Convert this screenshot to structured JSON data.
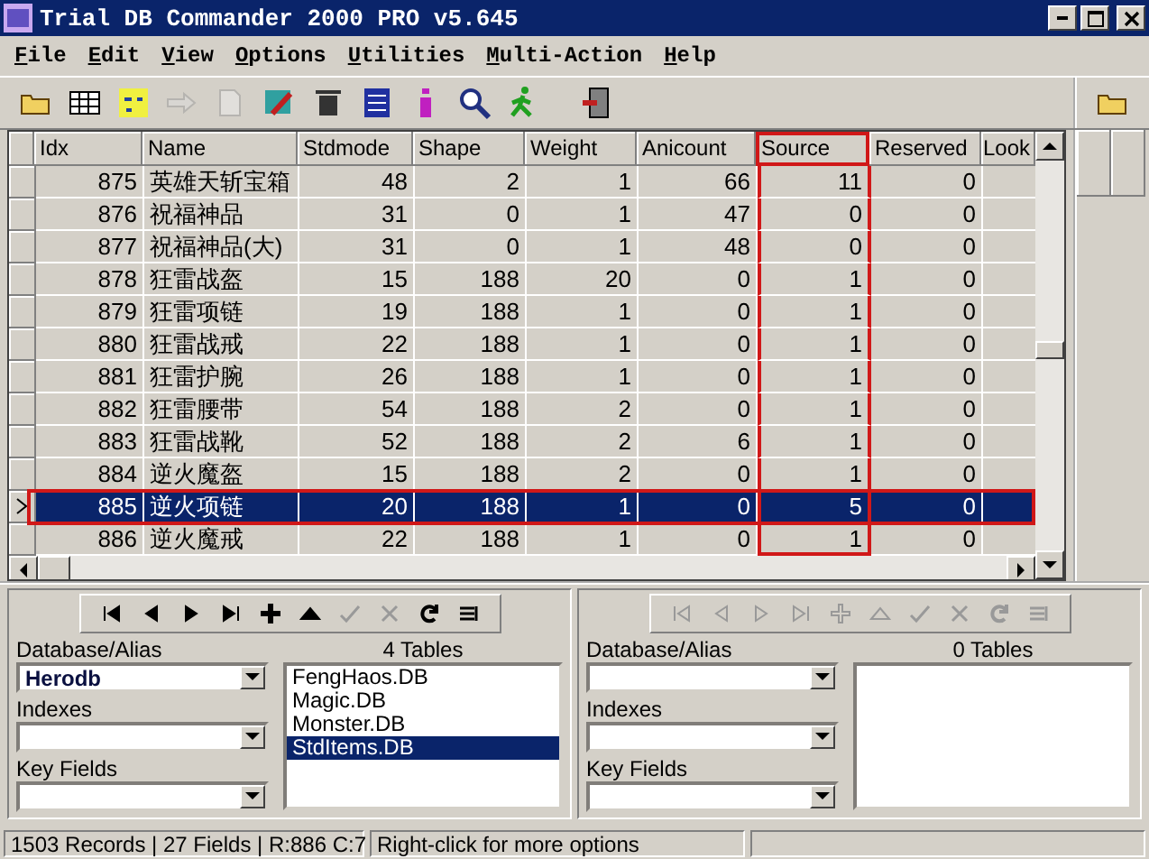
{
  "window": {
    "title": "Trial DB Commander 2000 PRO v5.645"
  },
  "menu": [
    "File",
    "Edit",
    "View",
    "Options",
    "Utilities",
    "Multi-Action",
    "Help"
  ],
  "toolbar": [
    {
      "kind": "folder",
      "disabled": false
    },
    {
      "kind": "table",
      "disabled": false
    },
    {
      "kind": "sql",
      "disabled": false
    },
    {
      "kind": "arrow",
      "disabled": true
    },
    {
      "kind": "doc",
      "disabled": true
    },
    {
      "kind": "paint",
      "disabled": false
    },
    {
      "kind": "trash",
      "disabled": false
    },
    {
      "kind": "grid",
      "disabled": false
    },
    {
      "kind": "info",
      "disabled": false
    },
    {
      "kind": "find",
      "disabled": false
    },
    {
      "kind": "run",
      "disabled": false
    },
    {
      "kind": "exit",
      "disabled": false
    }
  ],
  "table": {
    "columns": [
      {
        "label": "Idx",
        "highlighted": false
      },
      {
        "label": "Name",
        "highlighted": false
      },
      {
        "label": "Stdmode",
        "highlighted": false
      },
      {
        "label": "Shape",
        "highlighted": false
      },
      {
        "label": "Weight",
        "highlighted": false
      },
      {
        "label": "Anicount",
        "highlighted": false
      },
      {
        "label": "Source",
        "highlighted": true
      },
      {
        "label": "Reserved",
        "highlighted": false
      },
      {
        "label": "Look",
        "highlighted": false
      }
    ],
    "rows": [
      {
        "cells": [
          "875",
          "英雄天斩宝箱",
          "48",
          "2",
          "1",
          "66",
          "11",
          "0"
        ],
        "selected": false,
        "highlighted": false
      },
      {
        "cells": [
          "876",
          "祝福神品",
          "31",
          "0",
          "1",
          "47",
          "0",
          "0"
        ],
        "selected": false,
        "highlighted": false
      },
      {
        "cells": [
          "877",
          "祝福神品(大)",
          "31",
          "0",
          "1",
          "48",
          "0",
          "0"
        ],
        "selected": false,
        "highlighted": false
      },
      {
        "cells": [
          "878",
          "狂雷战盔",
          "15",
          "188",
          "20",
          "0",
          "1",
          "0"
        ],
        "selected": false,
        "highlighted": false
      },
      {
        "cells": [
          "879",
          "狂雷项链",
          "19",
          "188",
          "1",
          "0",
          "1",
          "0"
        ],
        "selected": false,
        "highlighted": false
      },
      {
        "cells": [
          "880",
          "狂雷战戒",
          "22",
          "188",
          "1",
          "0",
          "1",
          "0"
        ],
        "selected": false,
        "highlighted": false
      },
      {
        "cells": [
          "881",
          "狂雷护腕",
          "26",
          "188",
          "1",
          "0",
          "1",
          "0"
        ],
        "selected": false,
        "highlighted": false
      },
      {
        "cells": [
          "882",
          "狂雷腰带",
          "54",
          "188",
          "2",
          "0",
          "1",
          "0"
        ],
        "selected": false,
        "highlighted": false
      },
      {
        "cells": [
          "883",
          "狂雷战靴",
          "52",
          "188",
          "2",
          "6",
          "1",
          "0"
        ],
        "selected": false,
        "highlighted": false
      },
      {
        "cells": [
          "884",
          "逆火魔盔",
          "15",
          "188",
          "2",
          "0",
          "1",
          "0"
        ],
        "selected": false,
        "highlighted": false
      },
      {
        "cells": [
          "885",
          "逆火项链",
          "20",
          "188",
          "1",
          "0",
          "5",
          "0"
        ],
        "selected": true,
        "highlighted": true
      },
      {
        "cells": [
          "886",
          "逆火魔戒",
          "22",
          "188",
          "1",
          "0",
          "1",
          "0"
        ],
        "selected": false,
        "highlighted": false
      }
    ]
  },
  "panes": [
    {
      "nav": [
        {
          "kind": "first",
          "disabled": false
        },
        {
          "kind": "prior",
          "disabled": false
        },
        {
          "kind": "next",
          "disabled": false
        },
        {
          "kind": "last",
          "disabled": false
        },
        {
          "kind": "insert",
          "disabled": false
        },
        {
          "kind": "delete",
          "disabled": false
        },
        {
          "kind": "post",
          "disabled": true
        },
        {
          "kind": "cancel",
          "disabled": true
        },
        {
          "kind": "refresh",
          "disabled": false
        },
        {
          "kind": "filter",
          "disabled": false
        }
      ],
      "database_label": "Database/Alias",
      "database_value": "Herodb",
      "indexes_label": "Indexes",
      "key_fields_label": "Key Fields",
      "tables_count": "4 Tables",
      "tables": [
        {
          "name": "FengHaos.DB",
          "selected": false
        },
        {
          "name": "Magic.DB",
          "selected": false
        },
        {
          "name": "Monster.DB",
          "selected": false
        },
        {
          "name": "StdItems.DB",
          "selected": true
        }
      ]
    },
    {
      "nav": [
        {
          "kind": "first",
          "disabled": true
        },
        {
          "kind": "prior",
          "disabled": true
        },
        {
          "kind": "next",
          "disabled": true
        },
        {
          "kind": "last",
          "disabled": true
        },
        {
          "kind": "insert",
          "disabled": true
        },
        {
          "kind": "delete",
          "disabled": true
        },
        {
          "kind": "post",
          "disabled": true
        },
        {
          "kind": "cancel",
          "disabled": true
        },
        {
          "kind": "refresh",
          "disabled": true
        },
        {
          "kind": "filter",
          "disabled": true
        }
      ],
      "database_label": "Database/Alias",
      "indexes_label": "Indexes",
      "key_fields_label": "Key Fields",
      "tables_count": "0 Tables"
    }
  ],
  "status_bar": [
    "1503 Records | 27 Fields | R:886 C:7",
    "Right-click for more options"
  ]
}
